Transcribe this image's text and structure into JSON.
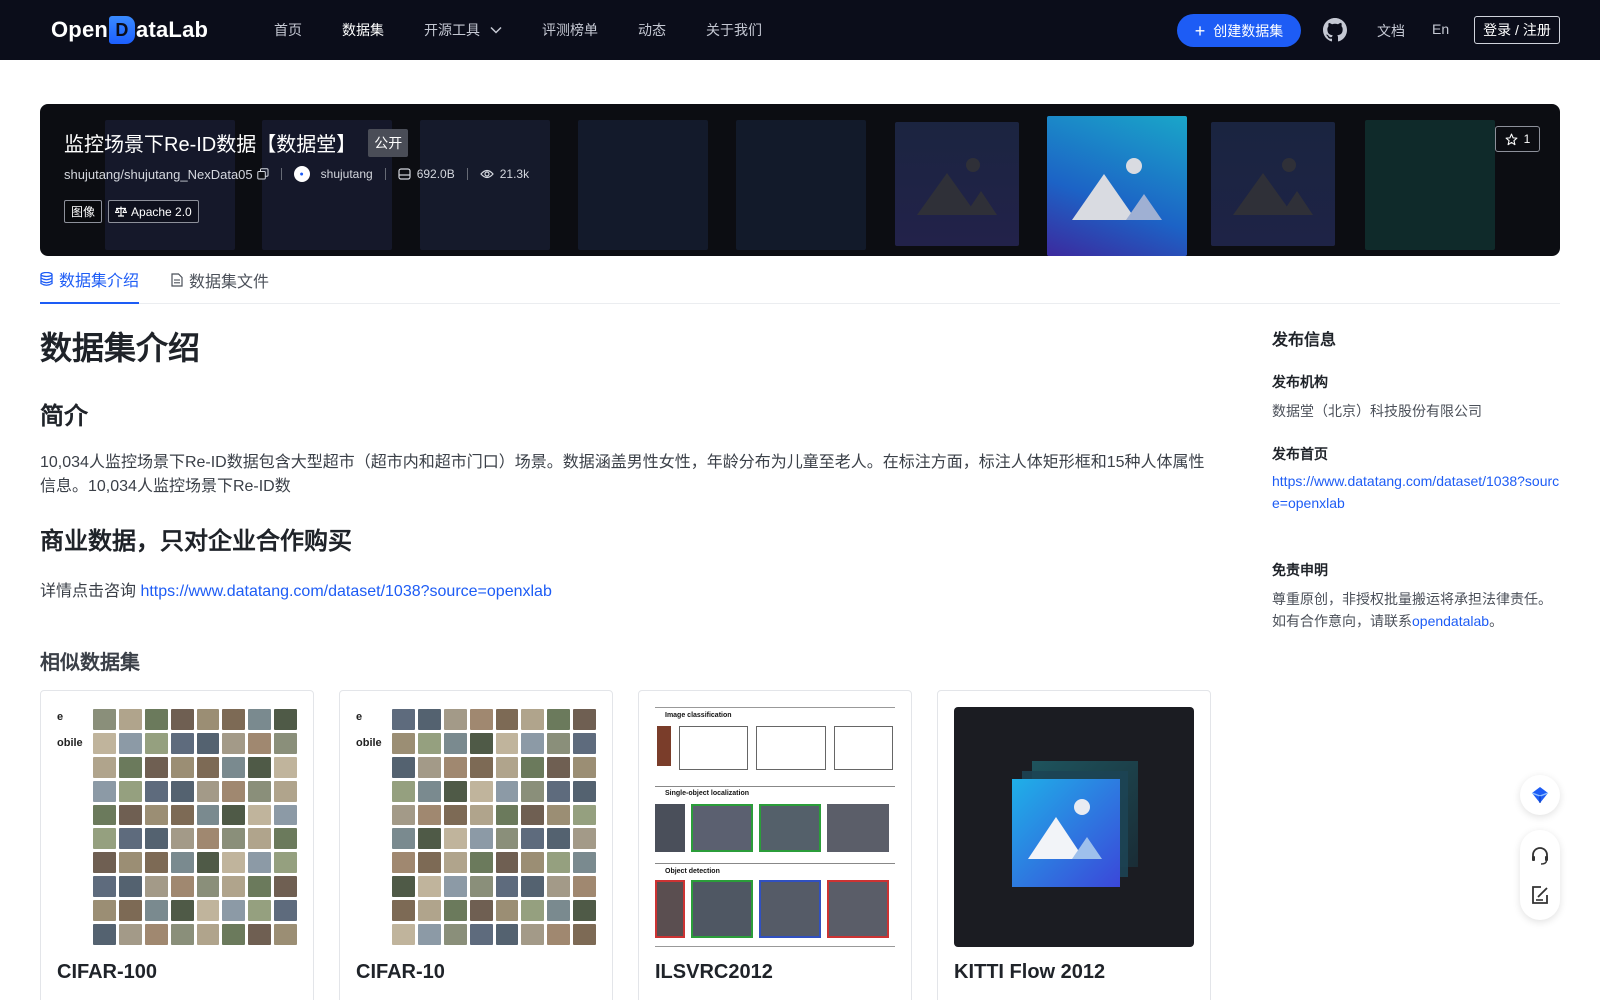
{
  "nav": {
    "logo_prefix": "Open",
    "logo_d": "D",
    "logo_suffix": "ataLab",
    "items": [
      {
        "label": "首页",
        "active": false
      },
      {
        "label": "数据集",
        "active": true
      },
      {
        "label": "开源工具",
        "active": false,
        "dropdown": true
      },
      {
        "label": "评测榜单",
        "active": false
      },
      {
        "label": "动态",
        "active": false
      },
      {
        "label": "关于我们",
        "active": false
      }
    ],
    "create_label": "创建数据集",
    "docs_label": "文档",
    "lang_label": "En",
    "login_label": "登录 / 注册",
    "icons": {
      "create": "plus-icon",
      "github": "github-icon",
      "dropdown": "chevron-down-icon"
    }
  },
  "banner": {
    "title": "监控场景下Re-ID数据【数据堂】",
    "visibility": "公开",
    "repo": "shujutang/shujutang_NexData05",
    "owner": "shujutang",
    "size": "692.0B",
    "views": "21.3k",
    "tags": [
      "图像",
      "Apache 2.0"
    ],
    "stars": "1",
    "accent": "#1d5cf5"
  },
  "tabs": [
    {
      "label": "数据集介绍",
      "active": true,
      "icon": "database-icon"
    },
    {
      "label": "数据集文件",
      "active": false,
      "icon": "file-icon"
    }
  ],
  "content": {
    "heading": "数据集介绍",
    "intro_heading": "简介",
    "intro_text": "10,034人监控场景下Re-ID数据包含大型超市（超市内和超市门口）场景。数据涵盖男性女性，年龄分布为儿童至老人。在标注方面，标注人体矩形框和15种人体属性信息。10,034人监控场景下Re-ID数",
    "commercial_heading": "商业数据，只对企业合作购买",
    "contact_prefix": "详情点击咨询 ",
    "contact_link": "https://www.datatang.com/dataset/1038?source=openxlab",
    "similar_heading": "相似数据集"
  },
  "similar": [
    {
      "name": "CIFAR-100",
      "label_top": "e",
      "label_bottom": "obile"
    },
    {
      "name": "CIFAR-10",
      "label_top": "e",
      "label_bottom": "obile"
    },
    {
      "name": "ILSVRC2012",
      "rows": [
        "Image classification",
        "Single-object localization",
        "Object detection"
      ]
    },
    {
      "name": "KITTI Flow 2012"
    }
  ],
  "sidebar": {
    "title": "发布信息",
    "org_label": "发布机构",
    "org_value": "数据堂（北京）科技股份有限公司",
    "home_label": "发布首页",
    "home_value": "https://www.datatang.com/dataset/1038?source=openxlab",
    "disclaimer_label": "免责申明",
    "disclaimer_text": "尊重原创，非授权批量搬运将承担法律责任。如有合作意向，请联系",
    "disclaimer_link": "opendatalab",
    "disclaimer_end": "。"
  }
}
